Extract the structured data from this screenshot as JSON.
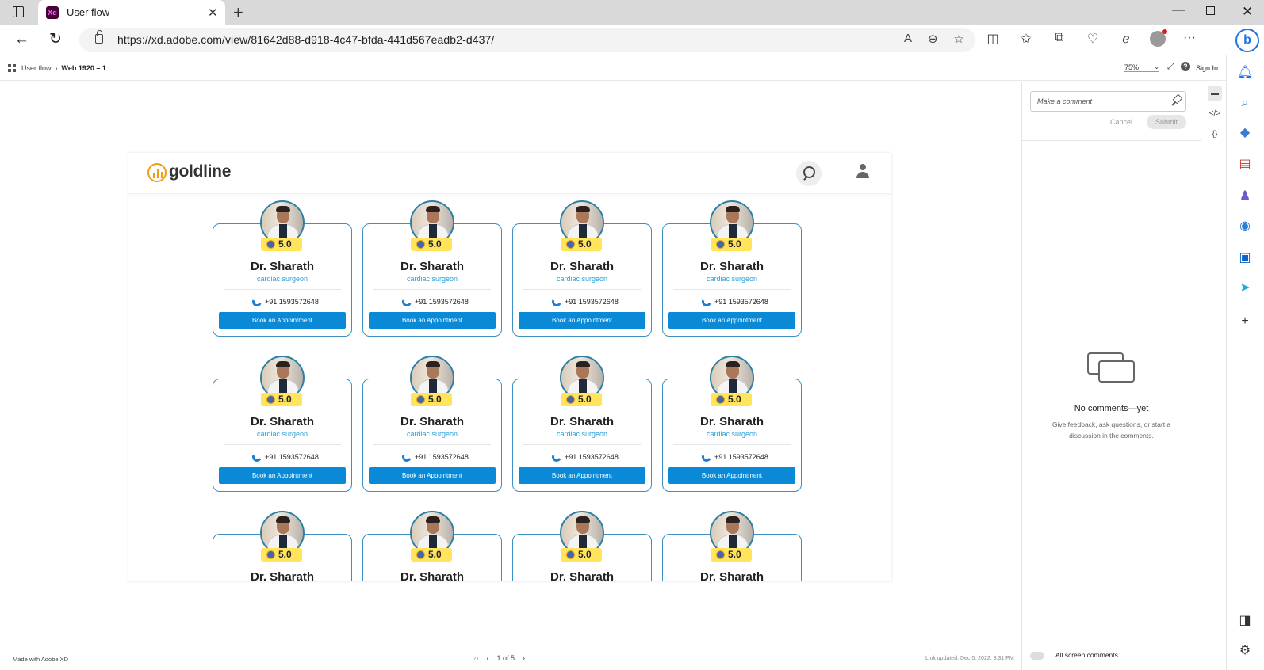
{
  "browser": {
    "tab_title": "User flow",
    "tab_favicon_text": "Xd",
    "url": "https://xd.adobe.com/view/81642d88-d918-4c47-bfda-441d567eadb2-d437/"
  },
  "xd": {
    "breadcrumb_root": "User flow",
    "breadcrumb_current": "Web 1920 – 1",
    "zoom": "75%",
    "sign_in": "Sign In"
  },
  "artboard": {
    "logo_text": "goldline",
    "doctor_card": {
      "rating": "5.0",
      "name": "Dr. Sharath",
      "specialty": "cardiac surgeon",
      "phone": "+91 1593572648",
      "book_label": "Book an Appointment"
    },
    "rows_visible": 3,
    "cols": 4
  },
  "comments": {
    "placeholder": "Make a comment",
    "cancel": "Cancel",
    "submit": "Submit",
    "empty_title": "No comments—yet",
    "empty_sub": "Give feedback, ask questions, or start a discussion in the comments.",
    "all_screen_label": "All screen comments"
  },
  "footer": {
    "made_with": "Made with Adobe XD",
    "page_indicator": "1 of 5",
    "link_updated": "Link updated: Dec 5, 2022, 3:31 PM"
  },
  "colors": {
    "accent_blue": "#0a8ad6",
    "rating_yellow": "#ffe45c",
    "logo_orange": "#f39c12"
  }
}
